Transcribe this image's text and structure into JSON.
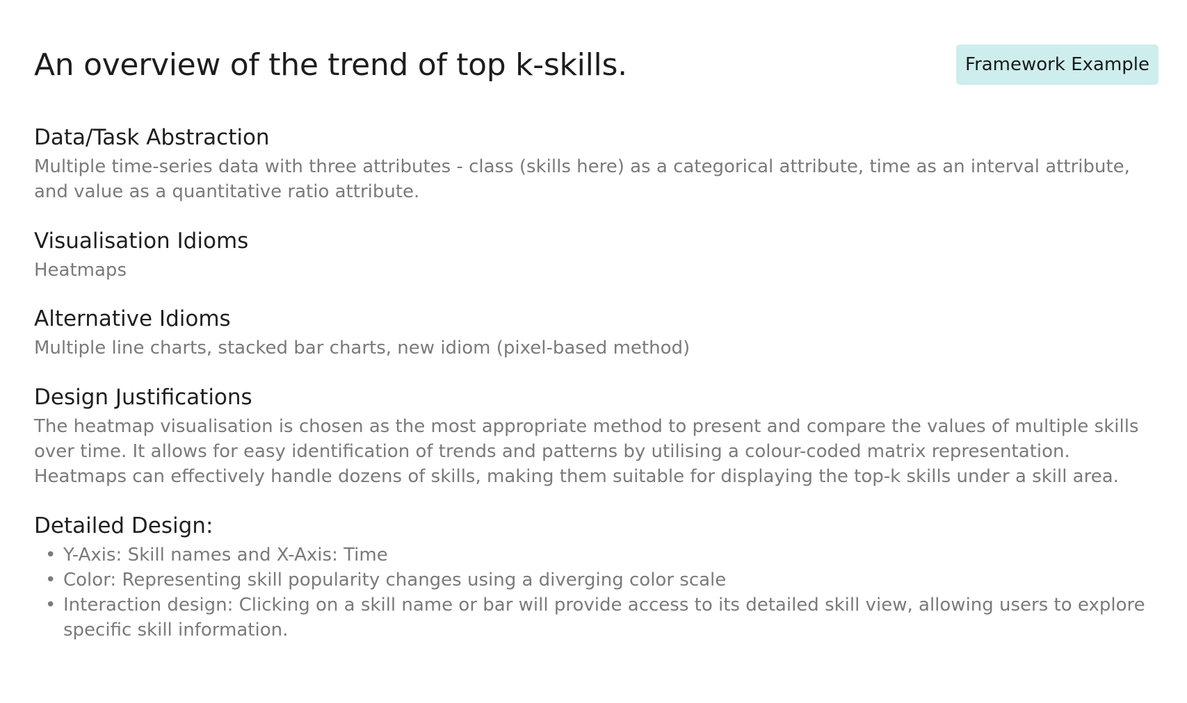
{
  "header": {
    "title": "An overview of the trend of top k-skills.",
    "badge": "Framework Example",
    "badge_color": "#cdeeec"
  },
  "sections": {
    "data_task": {
      "heading": "Data/Task Abstraction",
      "body": "Multiple time-series data with three attributes - class (skills here) as a categorical attribute, time as an interval attribute, and value as a quantitative ratio attribute."
    },
    "vis_idioms": {
      "heading": "Visualisation Idioms",
      "body": "Heatmaps"
    },
    "alt_idioms": {
      "heading": "Alternative Idioms",
      "body": "Multiple line charts, stacked bar charts, new idiom (pixel-based method)"
    },
    "justifications": {
      "heading": "Design Justifications",
      "body": "The heatmap visualisation is chosen as the most appropriate method to present and compare the values of multiple skills over time. It allows for easy identification of trends and patterns by utilising a colour-coded matrix representation. Heatmaps can effectively handle dozens of skills, making them suitable for displaying the top-k skills under a skill area."
    },
    "detailed": {
      "heading": "Detailed Design:",
      "items": [
        "Y-Axis: Skill names and X-Axis: Time",
        "Color: Representing skill popularity changes using a diverging color scale",
        "Interaction design: Clicking on a skill name or bar will provide access to its detailed skill view, allowing users to explore specific skill information."
      ]
    }
  }
}
